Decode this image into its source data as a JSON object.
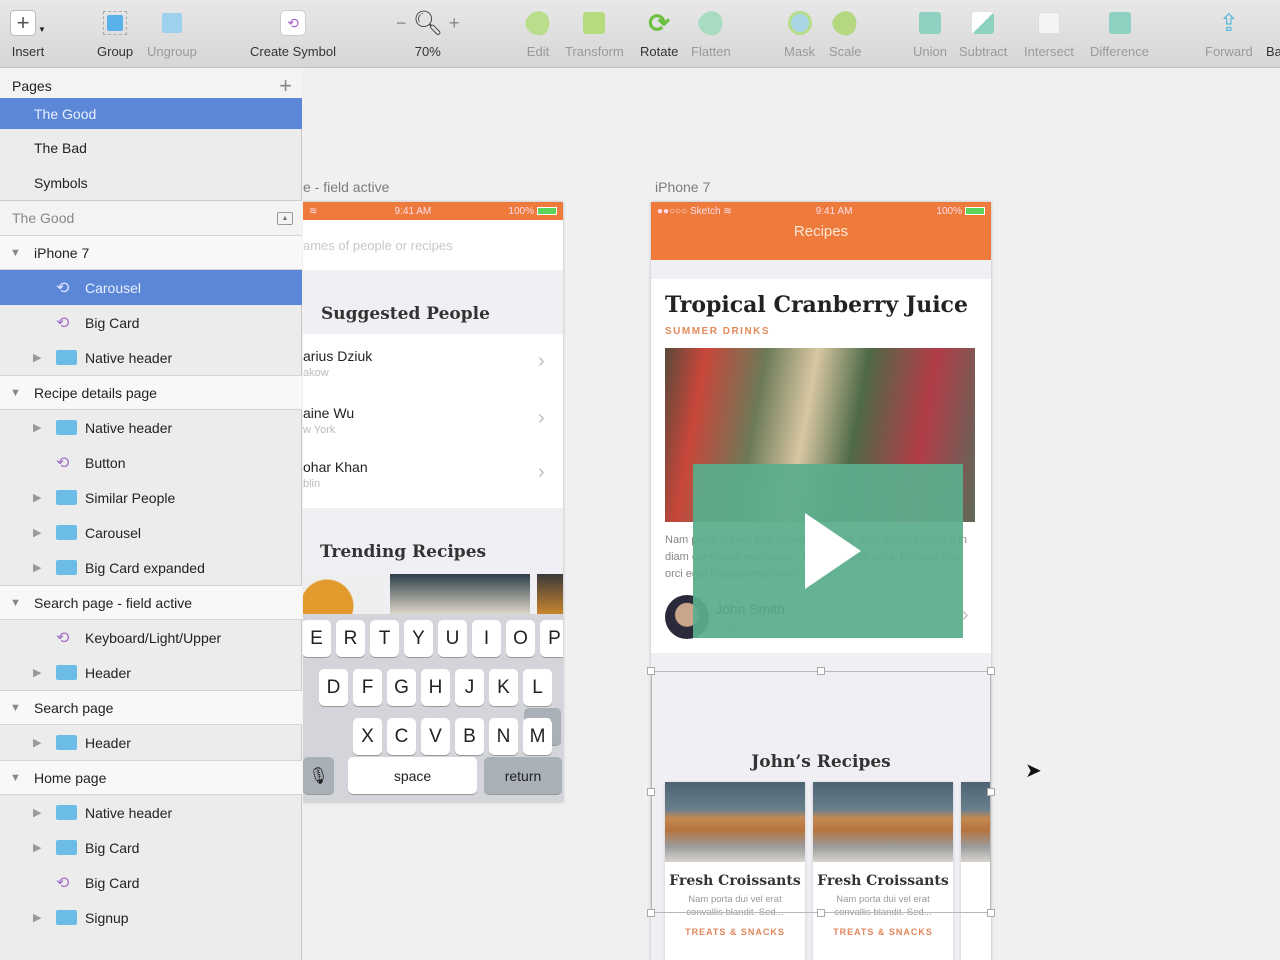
{
  "toolbar": {
    "items": [
      {
        "label": "Insert",
        "icon": "plus-icon"
      },
      {
        "label": "Group",
        "icon": "group-icon"
      },
      {
        "label": "Ungroup",
        "icon": "ungroup-icon"
      },
      {
        "label": "Create Symbol",
        "icon": "symbol-icon"
      },
      {
        "label": "70%",
        "icon": "zoom-icon",
        "minus": "−",
        "plus": "+"
      },
      {
        "label": "Edit",
        "icon": "edit-icon"
      },
      {
        "label": "Transform",
        "icon": "transform-icon"
      },
      {
        "label": "Rotate",
        "icon": "rotate-icon"
      },
      {
        "label": "Flatten",
        "icon": "flatten-icon"
      },
      {
        "label": "Mask",
        "icon": "mask-icon"
      },
      {
        "label": "Scale",
        "icon": "scale-icon"
      },
      {
        "label": "Union",
        "icon": "union-icon"
      },
      {
        "label": "Subtract",
        "icon": "subtract-icon"
      },
      {
        "label": "Intersect",
        "icon": "intersect-icon"
      },
      {
        "label": "Difference",
        "icon": "difference-icon"
      },
      {
        "label": "Forward",
        "icon": "forward-icon"
      },
      {
        "label": "Ba",
        "icon": "backward-icon"
      }
    ]
  },
  "sidebar": {
    "pages_title": "Pages",
    "add_page": "+",
    "pages": [
      "The Good",
      "The Bad",
      "Symbols"
    ],
    "current_page": "The Good",
    "layers": [
      {
        "label": "iPhone 7",
        "type": "artboard"
      },
      {
        "label": "Carousel",
        "type": "symbol",
        "selected": true
      },
      {
        "label": "Big Card",
        "type": "symbol"
      },
      {
        "label": "Native header",
        "type": "group"
      },
      {
        "label": "Recipe details page",
        "type": "artboard"
      },
      {
        "label": "Native header",
        "type": "group"
      },
      {
        "label": "Button",
        "type": "symbol"
      },
      {
        "label": "Similar People",
        "type": "group"
      },
      {
        "label": "Carousel",
        "type": "group"
      },
      {
        "label": "Big Card expanded",
        "type": "group"
      },
      {
        "label": "Search page - field active",
        "type": "artboard"
      },
      {
        "label": "Keyboard/Light/Upper",
        "type": "symbol"
      },
      {
        "label": "Header",
        "type": "group"
      },
      {
        "label": "Search page",
        "type": "artboard"
      },
      {
        "label": "Header",
        "type": "group"
      },
      {
        "label": "Home page",
        "type": "artboard"
      },
      {
        "label": "Native header",
        "type": "group"
      },
      {
        "label": "Big Card",
        "type": "group"
      },
      {
        "label": "Big Card",
        "type": "symbol"
      },
      {
        "label": "Signup",
        "type": "group"
      }
    ]
  },
  "canvas": {
    "search_artboard": {
      "label": "e - field active",
      "time": "9:41 AM",
      "battery": "100%",
      "search_placeholder": "ames of people or recipes",
      "suggested_title": "Suggested People",
      "people": [
        {
          "name": "arius Dziuk",
          "city": "akow"
        },
        {
          "name": "aine Wu",
          "city": "w York"
        },
        {
          "name": "ohar Khan",
          "city": "blin"
        }
      ],
      "trending_title": "Trending Recipes",
      "keyboard": {
        "row1": [
          "E",
          "R",
          "T",
          "Y",
          "U",
          "I",
          "O",
          "P"
        ],
        "row2": [
          "D",
          "F",
          "G",
          "H",
          "J",
          "K",
          "L"
        ],
        "row3": [
          "X",
          "C",
          "V",
          "B",
          "N",
          "M"
        ],
        "space": "space",
        "return": "return"
      }
    },
    "iphone_artboard": {
      "label": "iPhone 7",
      "carrier": "●●○○○ Sketch",
      "time": "9:41 AM",
      "battery": "100%",
      "nav_title": "Recipes",
      "card_title": "Tropical Cranberry Juice",
      "card_category": "SUMMER DRINKS",
      "card_text": "Nam porta dui vel erat convallis blandit. Sed tempus magna in diam commodo vestibulum. Donec sapien urna, tristique nec orci eget feugiat vestibulum augue...",
      "author_name": "John Smith",
      "author_city": "London",
      "section_title": "John’s Recipes",
      "recipes": [
        {
          "title": "Fresh Croissants",
          "desc": "Nam porta dui vel erat convallis blandit. Sed...",
          "category": "TREATS & SNACKS"
        },
        {
          "title": "Fresh Croissants",
          "desc": "Nam porta dui vel erat convallis blandit. Sed...",
          "category": "TREATS & SNACKS"
        },
        {
          "title": "Fr",
          "desc": "N co",
          "category": "T"
        }
      ]
    }
  },
  "colors": {
    "accent_orange": "#ee7a3c",
    "selection_blue": "#5b87d6",
    "video_overlay": "#5aad8c"
  }
}
